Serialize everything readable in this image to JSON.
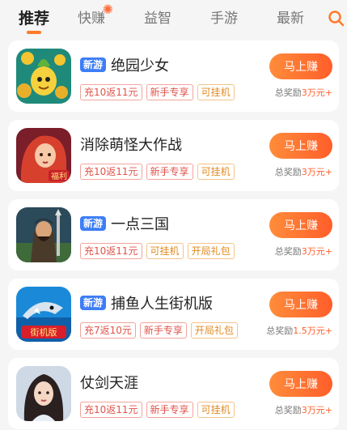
{
  "tabs": [
    {
      "label": "推荐",
      "active": true
    },
    {
      "label": "快赚",
      "spark": "✺"
    },
    {
      "label": "益智"
    },
    {
      "label": "手游"
    },
    {
      "label": "最新"
    }
  ],
  "colors": {
    "accent": "#ff6b2c",
    "new_badge": "#3d7df6",
    "tag_red": "#e0534a",
    "tag_orange": "#e28a1f"
  },
  "games": [
    {
      "icon": "golden-seed-monster-icon",
      "new_badge": "新游",
      "title": "绝园少女",
      "tags": [
        "充10返11元",
        "新手专享",
        "可挂机"
      ],
      "button": "马上赚",
      "reward_prefix": "总奖励",
      "reward_amount": "3万元+"
    },
    {
      "icon": "red-haired-girl-icon",
      "new_badge": "",
      "title": "消除萌怪大作战",
      "tags": [
        "充10返11元",
        "新手专享",
        "可挂机"
      ],
      "button": "马上赚",
      "reward_prefix": "总奖励",
      "reward_amount": "3万元+"
    },
    {
      "icon": "three-kingdoms-warrior-icon",
      "new_badge": "新游",
      "title": "一点三国",
      "tags": [
        "充10返11元",
        "可挂机",
        "开局礼包"
      ],
      "button": "马上赚",
      "reward_prefix": "总奖励",
      "reward_amount": "3万元+"
    },
    {
      "icon": "fishing-shark-icon",
      "new_badge": "新游",
      "title": "捕鱼人生街机版",
      "tags": [
        "充7返10元",
        "新手专享",
        "开局礼包"
      ],
      "button": "马上赚",
      "reward_prefix": "总奖励",
      "reward_amount": "1.5万元+"
    },
    {
      "icon": "sword-lady-icon",
      "new_badge": "",
      "title": "仗剑天涯",
      "tags": [
        "充10返11元",
        "新手专享",
        "可挂机"
      ],
      "button": "马上赚",
      "reward_prefix": "总奖励",
      "reward_amount": "3万元+"
    }
  ],
  "icon_texts": {
    "fishing_label": "街机版",
    "welfare_label": "福利"
  }
}
